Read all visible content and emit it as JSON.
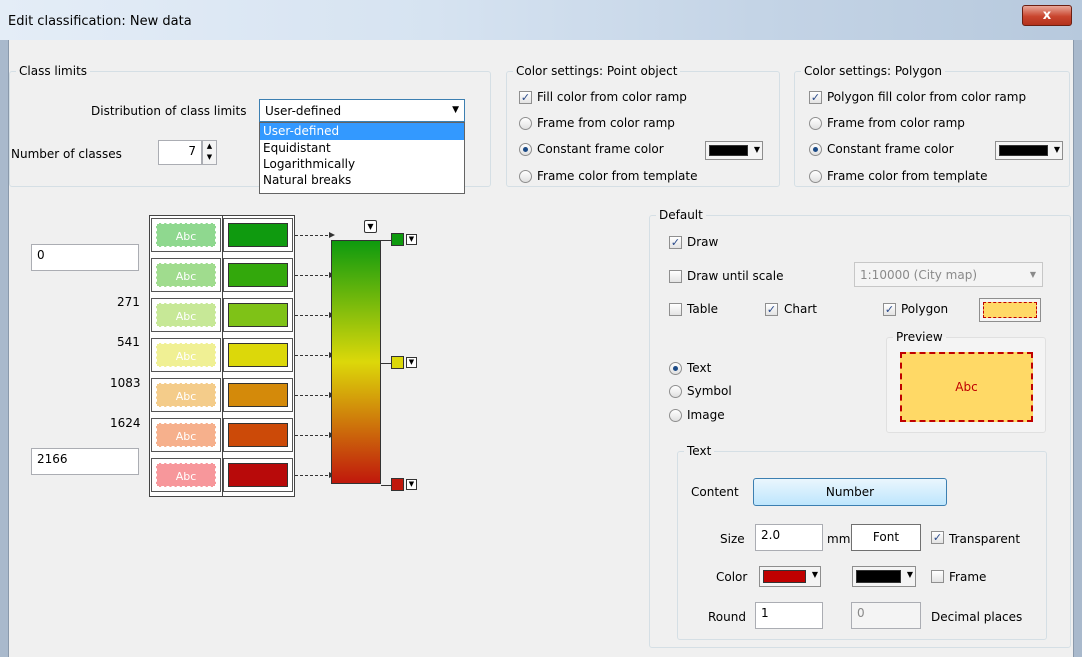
{
  "window": {
    "title": "Edit classification: New data",
    "close_label": "x"
  },
  "class_limits": {
    "legend": "Class limits",
    "distribution_label": "Distribution of class limits",
    "distribution_value": "User-defined",
    "options": [
      "User-defined",
      "Equidistant",
      "Logarithmically",
      "Natural breaks"
    ],
    "num_classes_label": "Number of classes",
    "num_classes_value": "7"
  },
  "point_colors": {
    "legend": "Color settings: Point object",
    "fill_label": "Fill color from color ramp",
    "frame_ramp_label": "Frame from color ramp",
    "constant_label": "Constant frame color",
    "template_label": "Frame color from template",
    "frame_color": "#000000"
  },
  "polygon_colors": {
    "legend": "Color settings: Polygon",
    "fill_label": "Polygon fill color from color ramp",
    "frame_ramp_label": "Frame from color ramp",
    "constant_label": "Constant frame color",
    "template_label": "Frame color from template",
    "frame_color": "#000000"
  },
  "limits": {
    "start": "0",
    "values": [
      "271",
      "541",
      "1083",
      "1624"
    ],
    "end": "2166"
  },
  "classes": [
    {
      "fill": "#8fd88f",
      "color": "#0f9a0f",
      "text": "Abc"
    },
    {
      "fill": "#a0dc8e",
      "color": "#33a80c",
      "text": "Abc"
    },
    {
      "fill": "#c7e897",
      "color": "#7fc217",
      "text": "Abc"
    },
    {
      "fill": "#f0f094",
      "color": "#dcd80a",
      "text": "Abc"
    },
    {
      "fill": "#f4cc8a",
      "color": "#d48a0a",
      "text": "Abc"
    },
    {
      "fill": "#f6b08c",
      "color": "#cc4a08",
      "text": "Abc"
    },
    {
      "fill": "#f7979b",
      "color": "#b80a0a",
      "text": "Abc"
    }
  ],
  "ramp_stops": [
    {
      "color": "#0e9a0e"
    },
    {
      "color": "#dcd80a"
    },
    {
      "color": "#c0180c"
    }
  ],
  "default": {
    "legend": "Default",
    "draw_label": "Draw",
    "draw_checked": true,
    "draw_until_label": "Draw until scale",
    "draw_until_checked": false,
    "scale_value": "1:10000 (City map)",
    "table_label": "Table",
    "table_checked": false,
    "chart_label": "Chart",
    "chart_checked": true,
    "polygon_label": "Polygon",
    "polygon_checked": true,
    "radio_text": "Text",
    "radio_symbol": "Symbol",
    "radio_image": "Image",
    "preview_legend": "Preview",
    "preview_text": "Abc"
  },
  "text_settings": {
    "legend": "Text",
    "content_label": "Content",
    "content_button": "Number",
    "size_label": "Size",
    "size_value": "2.0",
    "size_unit": "mm",
    "font_button": "Font",
    "transparent_label": "Transparent",
    "transparent_checked": true,
    "color_label": "Color",
    "text_color": "#c00000",
    "frame_color": "#000000",
    "frame_label": "Frame",
    "frame_checked": false,
    "round_label": "Round",
    "round_value": "1",
    "decimals_value": "0",
    "decimals_label": "Decimal places"
  }
}
